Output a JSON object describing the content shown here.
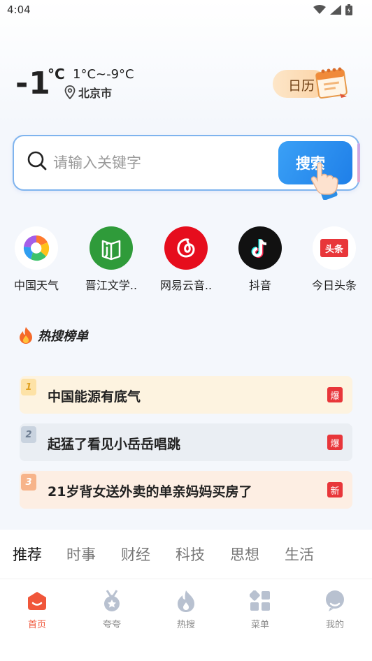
{
  "status_bar": {
    "time": "4:04"
  },
  "weather": {
    "temperature": "-1",
    "unit": "°C",
    "range": "1°C~-9°C",
    "location": "北京市"
  },
  "calendar": {
    "label": "日历"
  },
  "search": {
    "placeholder": "请输入关键字",
    "button_label": "搜索"
  },
  "apps": [
    {
      "label": "中国天气",
      "icon": "china-weather-icon"
    },
    {
      "label": "晋江文学..",
      "icon": "jinjiang-icon"
    },
    {
      "label": "网易云音..",
      "icon": "netease-music-icon"
    },
    {
      "label": "抖音",
      "icon": "douyin-icon"
    },
    {
      "label": "今日头条",
      "icon": "toutiao-icon",
      "icon_text": "头条"
    }
  ],
  "hot_list": {
    "title": "热搜榜单",
    "items": [
      {
        "rank": "1",
        "text": "中国能源有底气",
        "badge": "爆"
      },
      {
        "rank": "2",
        "text": "起猛了看见小岳岳唱跳",
        "badge": "爆"
      },
      {
        "rank": "3",
        "text": "21岁背女送外卖的单亲妈妈买房了",
        "badge": "新"
      }
    ]
  },
  "tabs": [
    "推荐",
    "时事",
    "财经",
    "科技",
    "思想",
    "生活"
  ],
  "bottom_nav": [
    {
      "label": "首页",
      "icon": "home-icon",
      "active": true
    },
    {
      "label": "夸夸",
      "icon": "medal-icon",
      "active": false
    },
    {
      "label": "热搜",
      "icon": "flame-icon",
      "active": false
    },
    {
      "label": "菜单",
      "icon": "menu-grid-icon",
      "active": false
    },
    {
      "label": "我的",
      "icon": "profile-icon",
      "active": false
    }
  ],
  "colors": {
    "accent": "#f0563a",
    "search_button": "#1f7fe8",
    "badge": "#e8363a"
  }
}
